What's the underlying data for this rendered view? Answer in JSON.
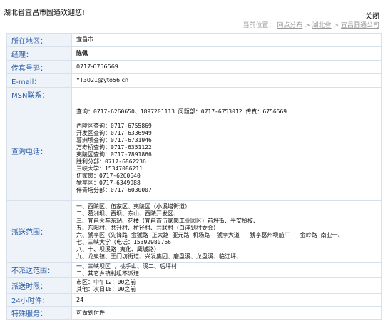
{
  "header": {
    "welcome": "湖北省宜昌市圆通欢迎您!",
    "close_label": "关闭"
  },
  "breadcrumb": {
    "prefix": "当前位置：",
    "items": [
      "网点分布",
      "湖北省",
      "宜昌圆通公司"
    ],
    "separator": ">"
  },
  "rows": [
    {
      "label": "所在地区：",
      "value": "宜昌市"
    },
    {
      "label": "经理：",
      "value": "陈佩"
    },
    {
      "label": "传真号码：",
      "value": "0717-6756569"
    },
    {
      "label": "E-mail：",
      "value": "YT3021@yto56.cn"
    },
    {
      "label": "MSN联系：",
      "value": ""
    },
    {
      "label": "查询电话：",
      "lines": [
        "查询：0717-6260650、1897201113 问题部：0717-6753012 传真：6756569",
        "",
        "西陵区查询：0717-6755869",
        "开发区查询：0717-6336949",
        "葛洲坝查询：0717-6731946",
        "万寿桥查询：0717-6351122",
        "夷陵区查询：0717-7891866",
        "胜利分部：0717-6862236",
        "三峡大学：15347086211",
        "伍家岗：0717-6260640",
        "猇亭区：0717-6349988",
        "伴青场分部：0717-6030007"
      ]
    },
    {
      "label": "派送范围：",
      "lines": [
        "一、西陵区、伍家区、夷陵区（小溪塔街道）",
        "二、葛洲坝、西坝、东山、西陵开发区、",
        "三、宜昌火车东站、花楼（宜昌市伍家岗工业园区）前坪街、平安贸校、",
        "五、东阳村、共升村、桥径村、共联村（白洋到村委会）",
        "六、猇亭区（先锋路 金猇路 正大路 亚元路 机场路  猇亭大道   猇亭葛州坝船厂   金岭路 南业一、",
        "七、三峡大学（电话：15392980766",
        "八、十、坝溪路 夷化、鹰城路）",
        "九、龙泉镇、王门坊街道、兴发集团、磨盘溪、龙盘溪、临江坪、"
      ]
    },
    {
      "label": "不派送范围：",
      "lines": [
        "一、三峡坝区 ，桃手山、溪二、后坪村",
        "二、其它乡镇村组不派送"
      ]
    },
    {
      "label": "派送时限：",
      "lines": [
        "市区：中午12：00之前",
        "其他：次日18：00之前"
      ]
    },
    {
      "label": "24小时件：",
      "value": "24"
    },
    {
      "label": "特殊服务：",
      "value": "可做到付件"
    }
  ]
}
